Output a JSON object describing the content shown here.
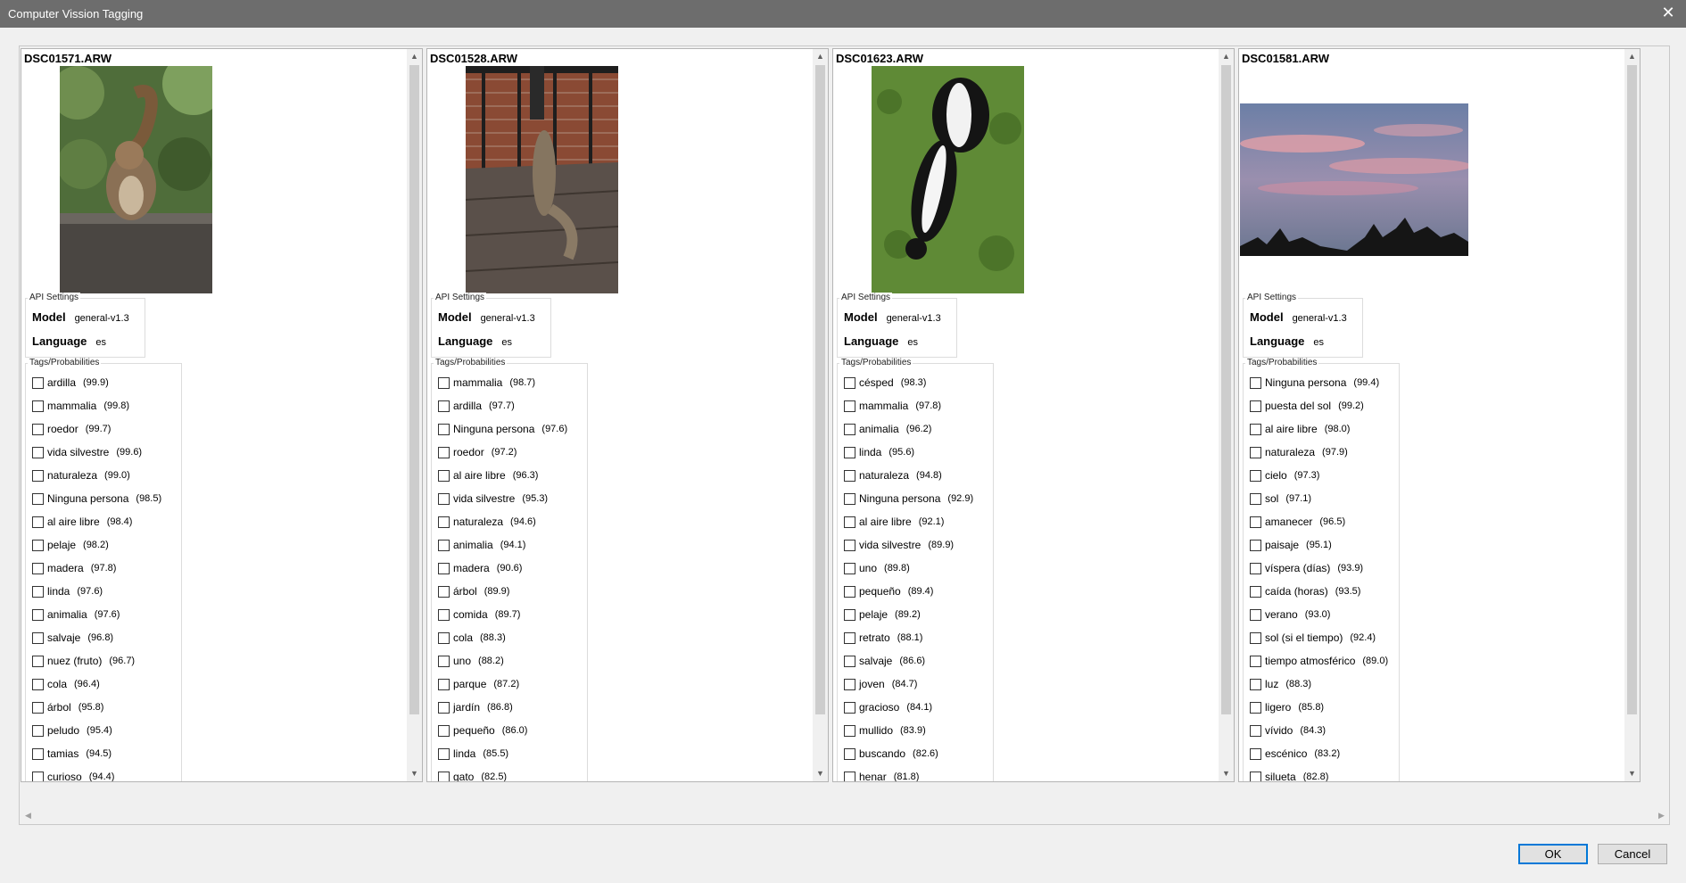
{
  "window": {
    "title": "Computer Vission Tagging",
    "close_glyph": "✕"
  },
  "scroll": {
    "up": "▲",
    "down": "▼",
    "left": "◀",
    "right": "▶"
  },
  "panels": [
    {
      "filename": "DSC01571.ARW",
      "photo_icon": "squirrel-photo",
      "api_legend": "API Settings",
      "model_label": "Model",
      "model_value": "general-v1.3",
      "language_label": "Language",
      "language_value": "es",
      "tags_legend": "Tags/Probabilities",
      "tags": [
        {
          "name": "ardilla",
          "prob": "(99.9)"
        },
        {
          "name": "mammalia",
          "prob": "(99.8)"
        },
        {
          "name": "roedor",
          "prob": "(99.7)"
        },
        {
          "name": "vida silvestre",
          "prob": "(99.6)"
        },
        {
          "name": "naturaleza",
          "prob": "(99.0)"
        },
        {
          "name": "Ninguna persona",
          "prob": "(98.5)"
        },
        {
          "name": "al aire libre",
          "prob": "(98.4)"
        },
        {
          "name": "pelaje",
          "prob": "(98.2)"
        },
        {
          "name": "madera",
          "prob": "(97.8)"
        },
        {
          "name": "linda",
          "prob": "(97.6)"
        },
        {
          "name": "animalia",
          "prob": "(97.6)"
        },
        {
          "name": "salvaje",
          "prob": "(96.8)"
        },
        {
          "name": "nuez (fruto)",
          "prob": "(96.7)"
        },
        {
          "name": "cola",
          "prob": "(96.4)"
        },
        {
          "name": "árbol",
          "prob": "(95.8)"
        },
        {
          "name": "peludo",
          "prob": "(95.4)"
        },
        {
          "name": "tamias",
          "prob": "(94.5)"
        },
        {
          "name": "curioso",
          "prob": "(94.4)"
        }
      ]
    },
    {
      "filename": "DSC01528.ARW",
      "photo_icon": "squirrel-feeder-photo",
      "api_legend": "API Settings",
      "model_label": "Model",
      "model_value": "general-v1.3",
      "language_label": "Language",
      "language_value": "es",
      "tags_legend": "Tags/Probabilities",
      "tags": [
        {
          "name": "mammalia",
          "prob": "(98.7)"
        },
        {
          "name": "ardilla",
          "prob": "(97.7)"
        },
        {
          "name": "Ninguna persona",
          "prob": "(97.6)"
        },
        {
          "name": "roedor",
          "prob": "(97.2)"
        },
        {
          "name": "al aire libre",
          "prob": "(96.3)"
        },
        {
          "name": "vida silvestre",
          "prob": "(95.3)"
        },
        {
          "name": "naturaleza",
          "prob": "(94.6)"
        },
        {
          "name": "animalia",
          "prob": "(94.1)"
        },
        {
          "name": "madera",
          "prob": "(90.6)"
        },
        {
          "name": "árbol",
          "prob": "(89.9)"
        },
        {
          "name": "comida",
          "prob": "(89.7)"
        },
        {
          "name": "cola",
          "prob": "(88.3)"
        },
        {
          "name": "uno",
          "prob": "(88.2)"
        },
        {
          "name": "parque",
          "prob": "(87.2)"
        },
        {
          "name": "jardín",
          "prob": "(86.8)"
        },
        {
          "name": "pequeño",
          "prob": "(86.0)"
        },
        {
          "name": "linda",
          "prob": "(85.5)"
        },
        {
          "name": "gato",
          "prob": "(82.5)"
        }
      ]
    },
    {
      "filename": "DSC01623.ARW",
      "photo_icon": "skunk-photo",
      "api_legend": "API Settings",
      "model_label": "Model",
      "model_value": "general-v1.3",
      "language_label": "Language",
      "language_value": "es",
      "tags_legend": "Tags/Probabilities",
      "tags": [
        {
          "name": "césped",
          "prob": "(98.3)"
        },
        {
          "name": "mammalia",
          "prob": "(97.8)"
        },
        {
          "name": "animalia",
          "prob": "(96.2)"
        },
        {
          "name": "linda",
          "prob": "(95.6)"
        },
        {
          "name": "naturaleza",
          "prob": "(94.8)"
        },
        {
          "name": "Ninguna persona",
          "prob": "(92.9)"
        },
        {
          "name": "al aire libre",
          "prob": "(92.1)"
        },
        {
          "name": "vida silvestre",
          "prob": "(89.9)"
        },
        {
          "name": "uno",
          "prob": "(89.8)"
        },
        {
          "name": "pequeño",
          "prob": "(89.4)"
        },
        {
          "name": "pelaje",
          "prob": "(89.2)"
        },
        {
          "name": "retrato",
          "prob": "(88.1)"
        },
        {
          "name": "salvaje",
          "prob": "(86.6)"
        },
        {
          "name": "joven",
          "prob": "(84.7)"
        },
        {
          "name": "gracioso",
          "prob": "(84.1)"
        },
        {
          "name": "mullido",
          "prob": "(83.9)"
        },
        {
          "name": "buscando",
          "prob": "(82.6)"
        },
        {
          "name": "henar",
          "prob": "(81.8)"
        }
      ]
    },
    {
      "filename": "DSC01581.ARW",
      "photo_icon": "sunset-sky-photo",
      "api_legend": "API Settings",
      "model_label": "Model",
      "model_value": "general-v1.3",
      "language_label": "Language",
      "language_value": "es",
      "tags_legend": "Tags/Probabilities",
      "tags": [
        {
          "name": "Ninguna persona",
          "prob": "(99.4)"
        },
        {
          "name": "puesta del sol",
          "prob": "(99.2)"
        },
        {
          "name": "al aire libre",
          "prob": "(98.0)"
        },
        {
          "name": "naturaleza",
          "prob": "(97.9)"
        },
        {
          "name": "cielo",
          "prob": "(97.3)"
        },
        {
          "name": "sol",
          "prob": "(97.1)"
        },
        {
          "name": "amanecer",
          "prob": "(96.5)"
        },
        {
          "name": "paisaje",
          "prob": "(95.1)"
        },
        {
          "name": "víspera (días)",
          "prob": "(93.9)"
        },
        {
          "name": "caída (horas)",
          "prob": "(93.5)"
        },
        {
          "name": "verano",
          "prob": "(93.0)"
        },
        {
          "name": "sol (si el tiempo)",
          "prob": "(92.4)"
        },
        {
          "name": "tiempo atmosférico",
          "prob": "(89.0)"
        },
        {
          "name": "luz",
          "prob": "(88.3)"
        },
        {
          "name": "ligero",
          "prob": "(85.8)"
        },
        {
          "name": "vívido",
          "prob": "(84.3)"
        },
        {
          "name": "escénico",
          "prob": "(83.2)"
        },
        {
          "name": "silueta",
          "prob": "(82.8)"
        }
      ]
    }
  ],
  "buttons": {
    "ok": "OK",
    "cancel": "Cancel"
  },
  "colors": {
    "titlebar": "#6d6d6d",
    "ok_border": "#0078d7"
  }
}
